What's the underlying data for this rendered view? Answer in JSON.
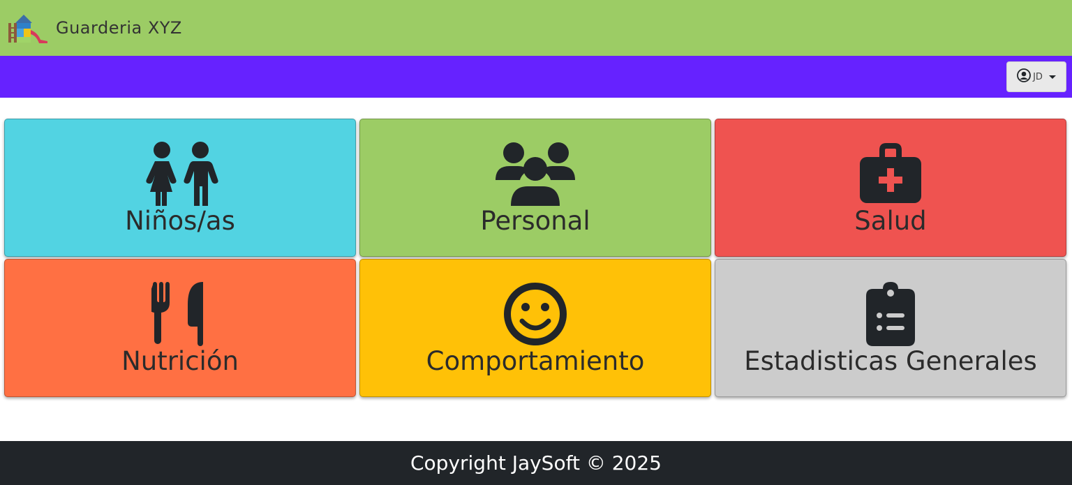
{
  "header": {
    "brand_name": "Guarderia XYZ",
    "logo_icon": "playground-slide-icon",
    "background_color": "#9ccc65"
  },
  "navbar": {
    "background_color": "#6622ff",
    "user_menu": {
      "icon": "user-circle-icon",
      "initials": "JD",
      "caret_icon": "caret-down-icon"
    }
  },
  "modules": [
    {
      "id": "ninos",
      "label": "Niños/as",
      "icon": "children-icon",
      "color": "#52d3e2"
    },
    {
      "id": "personal",
      "label": "Personal",
      "icon": "users-icon",
      "color": "#9ccc65"
    },
    {
      "id": "salud",
      "label": "Salud",
      "icon": "medical-kit-icon",
      "color": "#ef5350"
    },
    {
      "id": "nutricion",
      "label": "Nutrición",
      "icon": "utensils-icon",
      "color": "#ff7043"
    },
    {
      "id": "comportamiento",
      "label": "Comportamiento",
      "icon": "smile-icon",
      "color": "#ffc107"
    },
    {
      "id": "estadisticas",
      "label": "Estadisticas Generales",
      "icon": "clipboard-list-icon",
      "color": "#cccccc"
    }
  ],
  "footer": {
    "text": "Copyright JaySoft © 2025",
    "background_color": "#212529"
  }
}
